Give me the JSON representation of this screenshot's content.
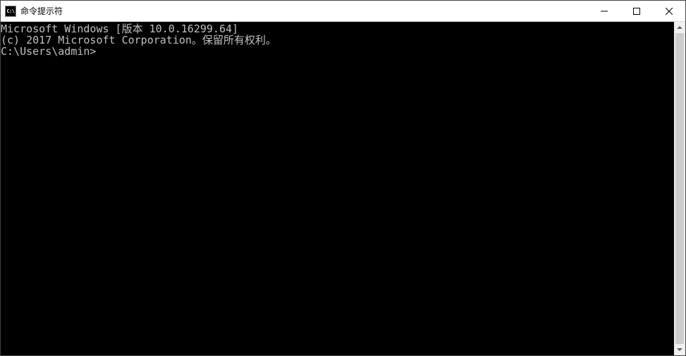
{
  "titlebar": {
    "icon_label": "C:\\",
    "title": "命令提示符"
  },
  "terminal": {
    "line1": "Microsoft Windows [版本 10.0.16299.64]",
    "line2": "(c) 2017 Microsoft Corporation。保留所有权利。",
    "blank": "",
    "prompt": "C:\\Users\\admin>"
  }
}
